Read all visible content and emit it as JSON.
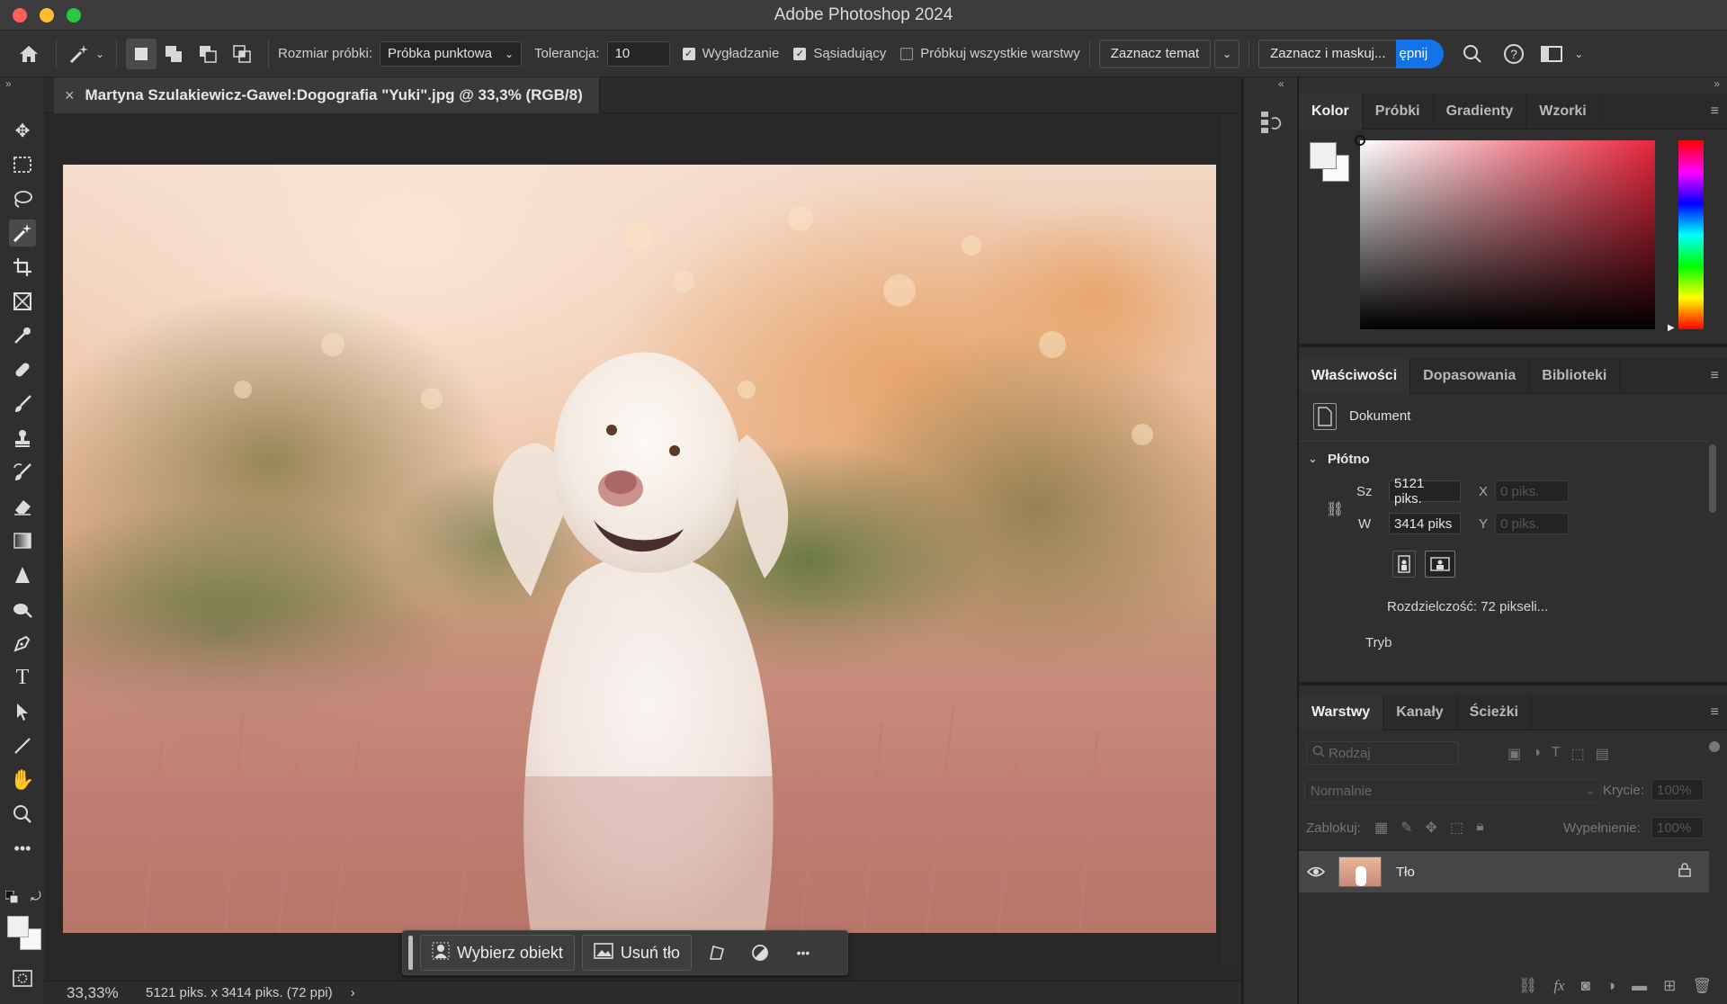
{
  "app": {
    "title": "Adobe Photoshop 2024"
  },
  "options_bar": {
    "sample_size_label": "Rozmiar próbki:",
    "sample_size_value": "Próbka punktowa",
    "tolerance_label": "Tolerancja:",
    "tolerance_value": "10",
    "antialias_label": "Wygładzanie",
    "contiguous_label": "Sąsiadujący",
    "sample_all_label": "Próbkuj wszystkie warstwy",
    "select_subject_label": "Zaznacz temat",
    "select_mask_label": "Zaznacz i maskuj...",
    "share_label": "ępnij",
    "icons": [
      "home-icon",
      "magic-wand-icon",
      "chevron-down-icon",
      "new-selection-icon",
      "add-selection-icon",
      "subtract-selection-icon",
      "intersect-selection-icon",
      "search-icon",
      "help-icon",
      "workspace-icon"
    ]
  },
  "document": {
    "tab_title": "Martyna Szulakiewicz-Gawel:Dogografia \"Yuki\".jpg @ 33,3% (RGB/8)",
    "close_symbol": "×",
    "zoom": "33,33%",
    "status_info": "5121 piks. x 3414 piks. (72 ppi)",
    "status_arrow": "›"
  },
  "contextual_bar": {
    "select_object": "Wybierz obiekt",
    "remove_bg": "Usuń tło",
    "more": "•••"
  },
  "color_panel": {
    "tabs": [
      "Kolor",
      "Próbki",
      "Gradienty",
      "Wzorki"
    ],
    "hue_color": "#e8263c"
  },
  "properties_panel": {
    "tabs": [
      "Właściwości",
      "Dopasowania",
      "Biblioteki"
    ],
    "doc_label": "Dokument",
    "section": "Płótno",
    "width_label": "Sz",
    "width_value": "5121 piks.",
    "height_label": "W",
    "height_value": "3414 piks",
    "x_label": "X",
    "x_placeholder": "0 piks.",
    "y_label": "Y",
    "y_placeholder": "0 piks.",
    "resolution": "Rozdzielczość: 72 pikseli...",
    "mode_label": "Tryb"
  },
  "layers_panel": {
    "tabs": [
      "Warstwy",
      "Kanały",
      "Ścieżki"
    ],
    "filter_placeholder": "Rodzaj",
    "blend_mode": "Normalnie",
    "opacity_label": "Krycie:",
    "opacity_value": "100%",
    "lock_label": "Zablokuj:",
    "fill_label": "Wypełnienie:",
    "fill_value": "100%",
    "layers": [
      {
        "name": "Tło",
        "visible": true,
        "locked": true
      }
    ]
  },
  "toolbar": {
    "tools": [
      "move-tool",
      "marquee-tool",
      "lasso-tool",
      "magic-wand-tool",
      "crop-tool",
      "frame-tool",
      "eyedropper-tool",
      "healing-tool",
      "brush-tool",
      "stamp-tool",
      "history-brush-tool",
      "eraser-tool",
      "gradient-tool",
      "blur-tool",
      "dodge-tool",
      "pen-tool",
      "type-tool",
      "path-select-tool",
      "line-tool",
      "hand-tool",
      "zoom-tool",
      "more-tools"
    ]
  }
}
